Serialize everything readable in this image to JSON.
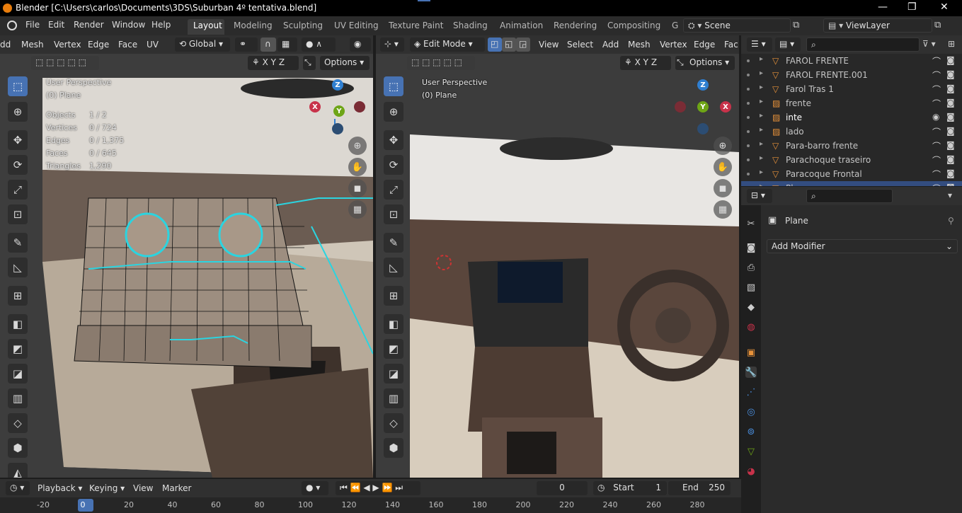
{
  "window": {
    "title": "Blender [C:\\Users\\carlos\\Documents\\3DS\\Suburban 4º tentativa.blend]",
    "min": "—",
    "max": "❐",
    "close": "✕"
  },
  "menu": {
    "items": [
      "File",
      "Edit",
      "Render",
      "Window",
      "Help"
    ],
    "workspaces": [
      "Layout",
      "Modeling",
      "Sculpting",
      "UV Editing",
      "Texture Paint",
      "Shading",
      "Animation",
      "Rendering",
      "Compositing",
      "G"
    ],
    "scene": "Scene",
    "view_layer": "ViewLayer"
  },
  "left_viewport": {
    "header_menu": [
      "dd",
      "Mesh",
      "Vertex",
      "Edge",
      "Face",
      "UV"
    ],
    "transform": "Global",
    "axes": [
      "X",
      "Y",
      "Z"
    ],
    "options": "Options",
    "perspective": "User Perspective",
    "object": "(0) Plane",
    "stats": [
      {
        "label": "Objects",
        "value": "1 / 2"
      },
      {
        "label": "Vertices",
        "value": "0 / 724"
      },
      {
        "label": "Edges",
        "value": "0 / 1,375"
      },
      {
        "label": "Faces",
        "value": "0 / 645"
      },
      {
        "label": "Triangles",
        "value": "1,290"
      }
    ]
  },
  "right_viewport": {
    "mode": "Edit Mode",
    "header_menu": [
      "View",
      "Select",
      "Add",
      "Mesh",
      "Vertex",
      "Edge",
      "Fac"
    ],
    "axes": [
      "X",
      "Y",
      "Z"
    ],
    "options": "Options",
    "perspective": "User Perspective",
    "object": "(0) Plane"
  },
  "outliner": {
    "rows": [
      {
        "name": "FAROL FRENTE"
      },
      {
        "name": "FAROL FRENTE.001"
      },
      {
        "name": "Farol Tras 1"
      },
      {
        "name": "frente"
      },
      {
        "name": "inte"
      },
      {
        "name": "lado"
      },
      {
        "name": "Para-barro frente"
      },
      {
        "name": "Parachoque traseiro"
      },
      {
        "name": "Paracoque Frontal"
      },
      {
        "name": "Plane"
      }
    ]
  },
  "properties": {
    "object_name": "Plane",
    "add_modifier": "Add Modifier"
  },
  "timeline": {
    "menus": [
      "Playback",
      "Keying",
      "View",
      "Marker"
    ],
    "current_frame": "0",
    "start_label": "Start",
    "start": "1",
    "end_label": "End",
    "end": "250",
    "ticks": [
      "-20",
      "0",
      "20",
      "40",
      "60",
      "80",
      "100",
      "120",
      "140",
      "160",
      "180",
      "200",
      "220",
      "240",
      "260",
      "280"
    ]
  },
  "colors": {
    "accent": "#4772b3",
    "axis_x": "#c8324a",
    "axis_y": "#6ea516",
    "axis_z": "#2f7fd1",
    "mesh_select": "#2bd4e0"
  }
}
